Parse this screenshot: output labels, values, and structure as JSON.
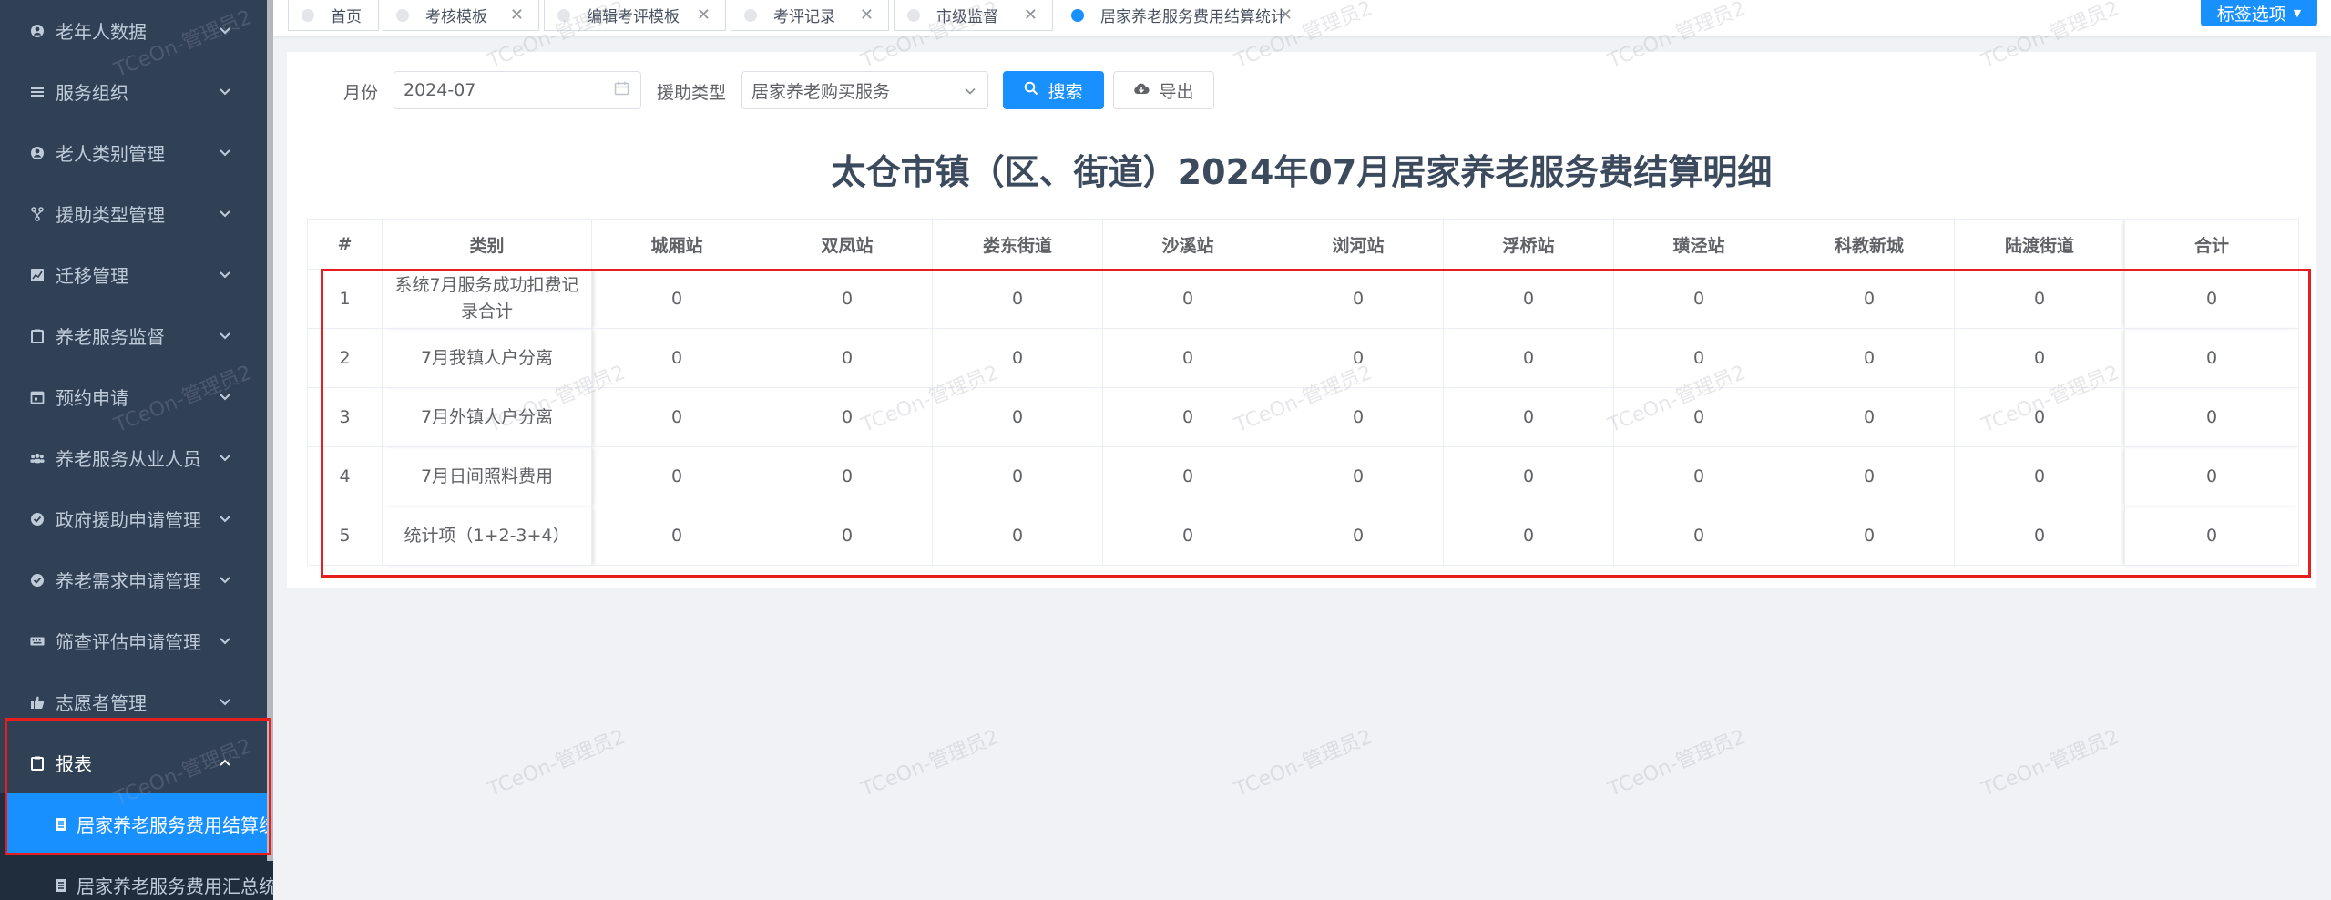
{
  "sidebar": {
    "items": [
      {
        "label": "老年人数据",
        "icon": "user-icon"
      },
      {
        "label": "服务组织",
        "icon": "list-icon"
      },
      {
        "label": "老人类别管理",
        "icon": "user-icon"
      },
      {
        "label": "援助类型管理",
        "icon": "tree-icon"
      },
      {
        "label": "迁移管理",
        "icon": "chart-icon"
      },
      {
        "label": "养老服务监督",
        "icon": "clipboard-icon"
      },
      {
        "label": "预约申请",
        "icon": "calendar-icon"
      },
      {
        "label": "养老服务从业人员",
        "icon": "group-icon"
      },
      {
        "label": "政府援助申请管理",
        "icon": "check-circle-icon"
      },
      {
        "label": "养老需求申请管理",
        "icon": "check-circle-icon"
      },
      {
        "label": "筛查评估申请管理",
        "icon": "keyboard-icon"
      },
      {
        "label": "志愿者管理",
        "icon": "thumbs-up-icon"
      }
    ],
    "report_menu": {
      "label": "报表",
      "icon": "clipboard-icon"
    },
    "report_children": [
      {
        "label": "居家养老服务费用结算统",
        "icon": "document-icon"
      },
      {
        "label": "居家养老服务费用汇总统计",
        "icon": "document-icon"
      }
    ]
  },
  "tabs": [
    {
      "label": "首页"
    },
    {
      "label": "考核模板"
    },
    {
      "label": "编辑考评模板"
    },
    {
      "label": "考评记录"
    },
    {
      "label": "市级监督"
    },
    {
      "label": "居家养老服务费用结算统计"
    }
  ],
  "tab_options": {
    "label": "标签选项"
  },
  "filters": {
    "month_label": "月份",
    "month_value": "2024-07",
    "aid_type_label": "援助类型",
    "aid_type_value": "居家养老购买服务",
    "search_label": "搜索",
    "export_label": "导出"
  },
  "report": {
    "title": "太仓市镇（区、街道）2024年07月居家养老服务费结算明细",
    "columns": [
      "#",
      "类别",
      "城厢站",
      "双凤站",
      "娄东街道",
      "沙溪站",
      "浏河站",
      "浮桥站",
      "璜泾站",
      "科教新城",
      "陆渡街道",
      "合计"
    ],
    "rows": [
      {
        "no": "1",
        "category": "系统7月服务成功扣费记录合计",
        "values": [
          "0",
          "0",
          "0",
          "0",
          "0",
          "0",
          "0",
          "0",
          "0"
        ],
        "total": "0"
      },
      {
        "no": "2",
        "category": "7月我镇人户分离",
        "values": [
          "0",
          "0",
          "0",
          "0",
          "0",
          "0",
          "0",
          "0",
          "0"
        ],
        "total": "0"
      },
      {
        "no": "3",
        "category": "7月外镇人户分离",
        "values": [
          "0",
          "0",
          "0",
          "0",
          "0",
          "0",
          "0",
          "0",
          "0"
        ],
        "total": "0"
      },
      {
        "no": "4",
        "category": "7月日间照料费用",
        "values": [
          "0",
          "0",
          "0",
          "0",
          "0",
          "0",
          "0",
          "0",
          "0"
        ],
        "total": "0"
      },
      {
        "no": "5",
        "category": "统计项（1+2-3+4）",
        "values": [
          "0",
          "0",
          "0",
          "0",
          "0",
          "0",
          "0",
          "0",
          "0"
        ],
        "total": "0"
      }
    ]
  },
  "watermark": "TCeOn-管理员2",
  "colors": {
    "primary": "#1890ff",
    "sidebar_bg": "#304156",
    "highlight": "#e81e1e"
  }
}
